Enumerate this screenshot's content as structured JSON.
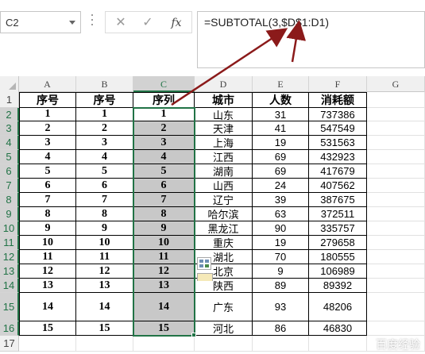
{
  "name_box": {
    "value": "C2"
  },
  "formula_bar": {
    "cancel_glyph": "✕",
    "enter_glyph": "✓",
    "fx_label": "fx",
    "formula": "=SUBTOTAL(3,$D$1:D1)"
  },
  "columns": [
    "A",
    "B",
    "C",
    "D",
    "E",
    "F",
    "G"
  ],
  "selected_column": "C",
  "rows": [
    "1",
    "2",
    "3",
    "4",
    "5",
    "6",
    "7",
    "8",
    "9",
    "10",
    "11",
    "12",
    "13",
    "14",
    "15",
    "16",
    "17"
  ],
  "header_row": [
    "序号",
    "序号",
    "序列",
    "城市",
    "人数",
    "消耗额"
  ],
  "data_rows": [
    {
      "a": "1",
      "b": "1",
      "c": "1",
      "city": "山东",
      "people": "31",
      "amount": "737386"
    },
    {
      "a": "2",
      "b": "2",
      "c": "2",
      "city": "天津",
      "people": "41",
      "amount": "547549"
    },
    {
      "a": "3",
      "b": "3",
      "c": "3",
      "city": "上海",
      "people": "19",
      "amount": "531563"
    },
    {
      "a": "4",
      "b": "4",
      "c": "4",
      "city": "江西",
      "people": "69",
      "amount": "432923"
    },
    {
      "a": "5",
      "b": "5",
      "c": "5",
      "city": "湖南",
      "people": "69",
      "amount": "417679"
    },
    {
      "a": "6",
      "b": "6",
      "c": "6",
      "city": "山西",
      "people": "24",
      "amount": "407562"
    },
    {
      "a": "7",
      "b": "7",
      "c": "7",
      "city": "辽宁",
      "people": "39",
      "amount": "387675"
    },
    {
      "a": "8",
      "b": "8",
      "c": "8",
      "city": "哈尔滨",
      "people": "63",
      "amount": "372511"
    },
    {
      "a": "9",
      "b": "9",
      "c": "9",
      "city": "黑龙江",
      "people": "90",
      "amount": "335757"
    },
    {
      "a": "10",
      "b": "10",
      "c": "10",
      "city": "重庆",
      "people": "19",
      "amount": "279658"
    },
    {
      "a": "11",
      "b": "11",
      "c": "11",
      "city": "湖北",
      "people": "70",
      "amount": "180555"
    },
    {
      "a": "12",
      "b": "12",
      "c": "12",
      "city": "北京",
      "people": "9",
      "amount": "106989"
    },
    {
      "a": "13",
      "b": "13",
      "c": "13",
      "city": "陕西",
      "people": "89",
      "amount": "89392"
    },
    {
      "a": "14",
      "b": "14",
      "c": "14",
      "city": "广东",
      "people": "93",
      "amount": "48206"
    },
    {
      "a": "15",
      "b": "15",
      "c": "15",
      "city": "河北",
      "people": "86",
      "amount": "46830"
    }
  ],
  "colors": {
    "selection": "#217346",
    "selected_fill": "#c8c8c8",
    "annotation_arrow": "#8b1a1a"
  },
  "icons": [
    "dropdown-arrow-icon",
    "cancel-icon",
    "enter-icon",
    "fx-icon",
    "quick-analysis-icon",
    "paste-options-icon"
  ],
  "watermark": "百度经验"
}
